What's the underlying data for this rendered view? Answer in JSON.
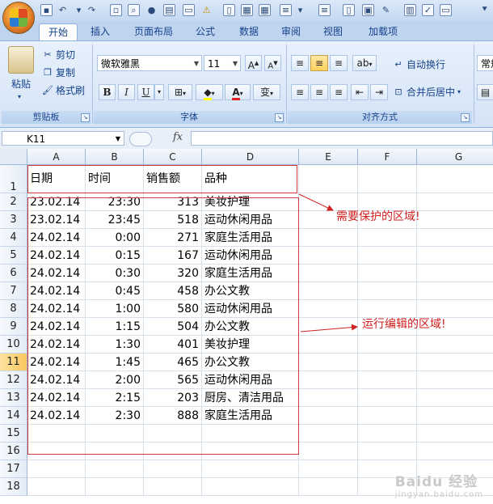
{
  "ribbon": {
    "tabs": [
      "开始",
      "插入",
      "页面布局",
      "公式",
      "数据",
      "审阅",
      "视图",
      "加载项"
    ],
    "active_tab": "开始",
    "clipboard": {
      "paste": "粘贴",
      "cut": "剪切",
      "copy": "复制",
      "format_painter": "格式刷",
      "label": "剪贴板"
    },
    "font": {
      "name": "微软雅黑",
      "size": "11",
      "grow": "A",
      "shrink": "A",
      "bold": "B",
      "italic": "I",
      "underline": "U",
      "font_color": "A",
      "phonetic": "变",
      "label": "字体"
    },
    "alignment": {
      "wrap_text": "自动换行",
      "merge_center": "合并后居中",
      "label": "对齐方式"
    },
    "number_format": "常规"
  },
  "formula_bar": {
    "name_box": "K11",
    "fx": "fx",
    "formula": ""
  },
  "grid": {
    "columns": [
      "A",
      "B",
      "C",
      "D",
      "E",
      "F",
      "G"
    ],
    "rows": [
      "1",
      "2",
      "3",
      "4",
      "5",
      "6",
      "7",
      "8",
      "9",
      "10",
      "11",
      "12",
      "13",
      "14",
      "15",
      "16",
      "17",
      "18"
    ],
    "selected_row": "11",
    "header": [
      "日期",
      "时间",
      "销售额",
      "品种"
    ],
    "data": [
      [
        "23.02.14",
        "23:30",
        "313",
        "美妆护理"
      ],
      [
        "23.02.14",
        "23:45",
        "518",
        "运动休闲用品"
      ],
      [
        "24.02.14",
        "0:00",
        "271",
        "家庭生活用品"
      ],
      [
        "24.02.14",
        "0:15",
        "167",
        "运动休闲用品"
      ],
      [
        "24.02.14",
        "0:30",
        "320",
        "家庭生活用品"
      ],
      [
        "24.02.14",
        "0:45",
        "458",
        "办公文教"
      ],
      [
        "24.02.14",
        "1:00",
        "580",
        "运动休闲用品"
      ],
      [
        "24.02.14",
        "1:15",
        "504",
        "办公文教"
      ],
      [
        "24.02.14",
        "1:30",
        "401",
        "美妆护理"
      ],
      [
        "24.02.14",
        "1:45",
        "465",
        "办公文教"
      ],
      [
        "24.02.14",
        "2:00",
        "565",
        "运动休闲用品"
      ],
      [
        "24.02.14",
        "2:15",
        "203",
        "厨房、清洁用品"
      ],
      [
        "24.02.14",
        "2:30",
        "888",
        "家庭生活用品"
      ]
    ]
  },
  "annotations": {
    "protected": "需要保护的区域!",
    "editable": "运行编辑的区域!",
    "annotation_color": "#d21f1f"
  },
  "watermark": {
    "brand": "Baidu 经验",
    "url": "jingyan.baidu.com"
  }
}
